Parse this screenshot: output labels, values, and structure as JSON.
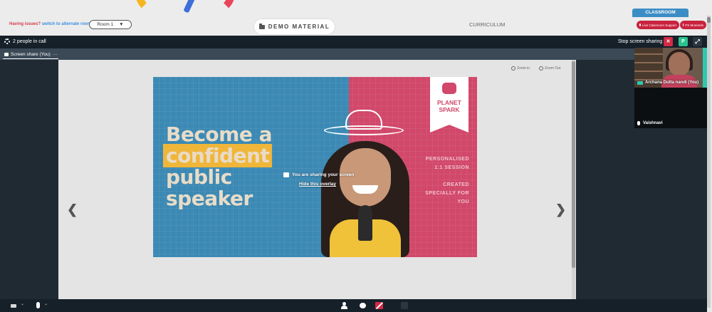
{
  "header": {
    "issues_text": "Having issues?",
    "alt_room_link": "switch to alternate room",
    "room_select": {
      "value": "Room 1"
    },
    "demo_material_label": "DEMO MATERIAL",
    "curriculum_label": "CURRICULUM",
    "classroom_label": "CLASSROOM",
    "classroom_support_label": "Live Classroom Support",
    "ps_moments_label": "PS Moments"
  },
  "call": {
    "people_count_text": "2 people in call",
    "stop_share_label": "Stop screen sharing",
    "p_button_label": "P",
    "tab_label": "Screen share (You)",
    "tab_more": "···"
  },
  "viewer": {
    "zoom_in_label": "Zoom in",
    "zoom_out_label": "Zoom Out"
  },
  "slide": {
    "headline_1": "Become a",
    "headline_2": "confident",
    "headline_3": "public",
    "headline_4": "speaker",
    "logo_1": "PLANET",
    "logo_2": "SPARK",
    "side_1": "PERSONALISED 1:1 SESSION",
    "side_2": "CREATED SPECIALLY FOR YOU"
  },
  "overlay": {
    "message": "You are sharing your screen",
    "hide_link": "Hide this overlay"
  },
  "participants": [
    {
      "name": "Archana Dutta nandi (You)"
    },
    {
      "name": "Vaishnavi"
    }
  ],
  "colors": {
    "accent_red": "#d42a46",
    "accent_green": "#29c28d",
    "classroom_blue": "#3c8dc5",
    "slide_blue": "#3b89b4",
    "slide_pink": "#d1486a"
  }
}
